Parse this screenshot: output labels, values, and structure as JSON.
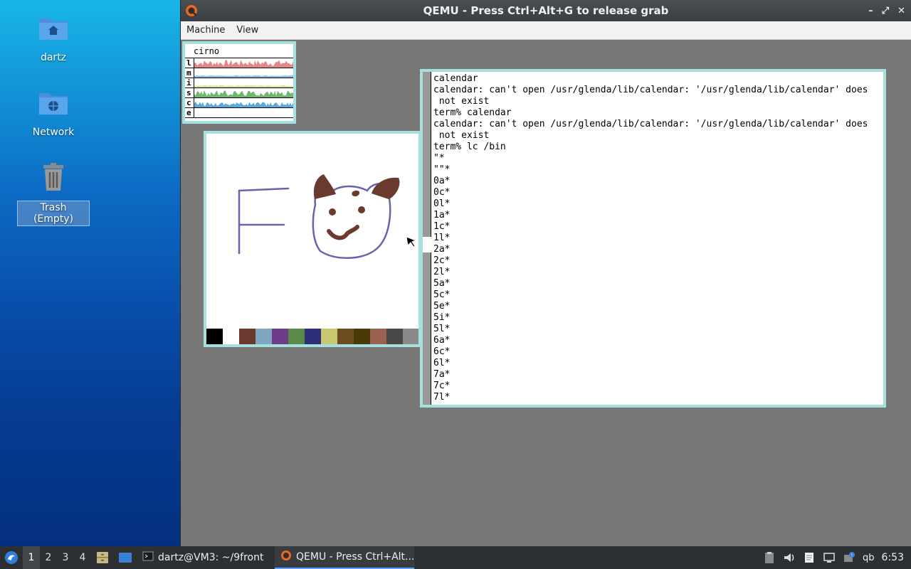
{
  "desktop": {
    "icons": [
      {
        "label": "dartz",
        "icon": "home-folder-icon"
      },
      {
        "label": "Network",
        "icon": "network-folder-icon"
      },
      {
        "label": "Trash (Empty)",
        "icon": "trash-icon"
      }
    ]
  },
  "qemu": {
    "title": "QEMU - Press Ctrl+Alt+G to release grab",
    "controls": {
      "minimize": "–",
      "maximize": "⤢",
      "close": "✕"
    },
    "menu": [
      "Machine",
      "View"
    ]
  },
  "stats": {
    "hostname": "cirno",
    "rows": [
      {
        "key": "l",
        "color": "#e07070"
      },
      {
        "key": "m",
        "color": "#70b0e0"
      },
      {
        "key": "i",
        "color": "#d8d870"
      },
      {
        "key": "s",
        "color": "#58a858"
      },
      {
        "key": "c",
        "color": "#3a9ad8"
      },
      {
        "key": "e",
        "color": "#888888"
      }
    ]
  },
  "paint": {
    "palette": [
      "#000000",
      "#ffffff",
      "#6b3a2e",
      "#7fa8c0",
      "#6d3d8a",
      "#5a8a48",
      "#2e2e7a",
      "#c8c870",
      "#6b4d20",
      "#4a3a08",
      "#9a6050",
      "#484848",
      "#8a8a8a"
    ],
    "brown": "#6b3a2e",
    "purple": "#6a62b0"
  },
  "terminal": {
    "lines": [
      "calendar",
      "calendar: can't open /usr/glenda/lib/calendar: '/usr/glenda/lib/calendar' does",
      " not exist",
      "term% calendar",
      "calendar: can't open /usr/glenda/lib/calendar: '/usr/glenda/lib/calendar' does",
      " not exist",
      "term% lc /bin",
      "\"*",
      "\"\"*",
      "0a*",
      "0c*",
      "0l*",
      "1a*",
      "1c*",
      "1l*",
      "2a*",
      "2c*",
      "2l*",
      "5a*",
      "5c*",
      "5e*",
      "5i*",
      "5l*",
      "6a*",
      "6c*",
      "6l*",
      "7a*",
      "7c*",
      "7l*"
    ]
  },
  "taskbar": {
    "workspaces": [
      "1",
      "2",
      "3",
      "4"
    ],
    "active_workspace": "1",
    "tasks": [
      {
        "label": "dartz@VM3: ~/9front",
        "icon": "terminal-icon"
      },
      {
        "label": "QEMU - Press Ctrl+Alt...",
        "icon": "qemu-icon"
      }
    ],
    "clock": "6:53",
    "keyboard_layout": "qb"
  },
  "colors": {
    "window_border": "#a7dfdf",
    "taskbar": "#2d3033",
    "guest_bg": "#777777"
  }
}
